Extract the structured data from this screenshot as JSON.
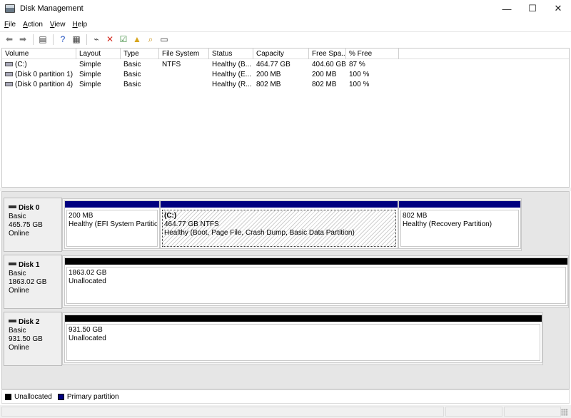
{
  "window": {
    "title": "Disk Management",
    "minimize": "—",
    "maximize": "☐",
    "close": "✕"
  },
  "menu": [
    {
      "key": "F",
      "rest": "ile"
    },
    {
      "key": "A",
      "rest": "ction"
    },
    {
      "key": "V",
      "rest": "iew"
    },
    {
      "key": "H",
      "rest": "elp"
    }
  ],
  "toolbar": [
    {
      "name": "back-icon",
      "glyph": "⬅",
      "color": "#7a7a7a"
    },
    {
      "name": "forward-icon",
      "glyph": "➡",
      "color": "#7a7a7a"
    },
    {
      "sep": true
    },
    {
      "name": "console-tree-icon",
      "glyph": "▤",
      "color": "#444444"
    },
    {
      "sep": true
    },
    {
      "name": "help-icon",
      "glyph": "?",
      "color": "#1f4fbf"
    },
    {
      "name": "properties-icon",
      "glyph": "▦",
      "color": "#444444"
    },
    {
      "sep": true
    },
    {
      "name": "connect-drive-icon",
      "glyph": "⌁",
      "color": "#444444"
    },
    {
      "name": "delete-icon",
      "glyph": "✕",
      "color": "#d42a1f"
    },
    {
      "name": "check-icon",
      "glyph": "☑",
      "color": "#3a8a3a"
    },
    {
      "name": "folder-up-icon",
      "glyph": "▲",
      "color": "#d7a51c"
    },
    {
      "name": "search-folder-icon",
      "glyph": "⌕",
      "color": "#c9941a"
    },
    {
      "name": "list-view-icon",
      "glyph": "▭",
      "color": "#3a3a3a"
    }
  ],
  "volumes": {
    "headers": [
      "Volume",
      "Layout",
      "Type",
      "File System",
      "Status",
      "Capacity",
      "Free Spa...",
      "% Free"
    ],
    "rows": [
      [
        "(C:)",
        "Simple",
        "Basic",
        "NTFS",
        "Healthy (B...",
        "464.77 GB",
        "404.60 GB",
        "87 %"
      ],
      [
        "(Disk 0 partition 1)",
        "Simple",
        "Basic",
        "",
        "Healthy (E...",
        "200 MB",
        "200 MB",
        "100 %"
      ],
      [
        "(Disk 0 partition 4)",
        "Simple",
        "Basic",
        "",
        "Healthy (R...",
        "802 MB",
        "802 MB",
        "100 %"
      ]
    ]
  },
  "disks": [
    {
      "name": "Disk 0",
      "type": "Basic",
      "size": "465.75 GB",
      "status": "Online",
      "partitions": [
        {
          "lines": [
            "200 MB",
            "Healthy (EFI System Partition"
          ],
          "bar": "#00007f",
          "hatched": false
        },
        {
          "lines": [
            "(C:)",
            "464.77 GB NTFS",
            "Healthy (Boot, Page File, Crash Dump, Basic Data Partition)"
          ],
          "bar": "#00007f",
          "hatched": true
        },
        {
          "lines": [
            "802 MB",
            "Healthy (Recovery Partition)"
          ],
          "bar": "#00007f",
          "hatched": false
        }
      ]
    },
    {
      "name": "Disk 1",
      "type": "Basic",
      "size": "1863.02 GB",
      "status": "Online",
      "partitions": [
        {
          "lines": [
            "1863.02 GB",
            "Unallocated"
          ],
          "bar": "#000000",
          "hatched": false
        }
      ]
    },
    {
      "name": "Disk 2",
      "type": "Basic",
      "size": "931.50 GB",
      "status": "Online",
      "partitions": [
        {
          "lines": [
            "931.50 GB",
            "Unallocated"
          ],
          "bar": "#000000",
          "hatched": false
        }
      ]
    }
  ],
  "legend": [
    {
      "label": "Unallocated",
      "color": "#000000"
    },
    {
      "label": "Primary partition",
      "color": "#00007f"
    }
  ]
}
